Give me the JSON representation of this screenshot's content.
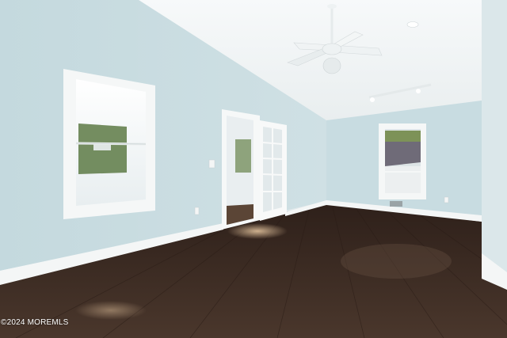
{
  "photo": {
    "watermark": "©2024 MOREMLS",
    "colors": {
      "wall_left": "#c9dde2",
      "wall_right": "#c7dbe0",
      "ceiling": "#f4f7f8",
      "floor": "#3b2a22",
      "trim": "#f8f9f9"
    }
  }
}
